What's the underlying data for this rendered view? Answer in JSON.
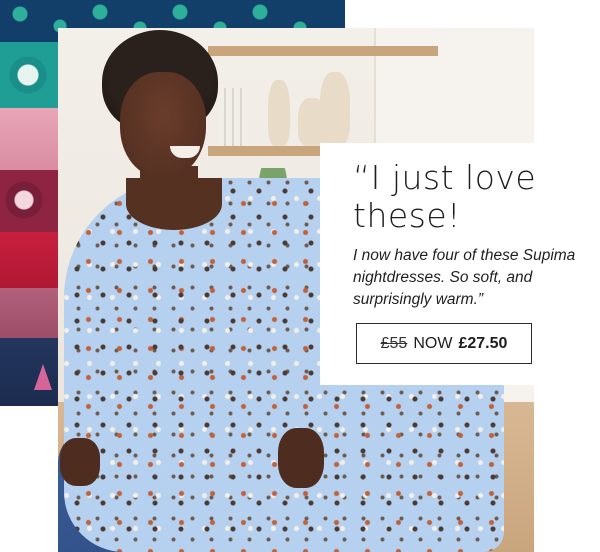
{
  "quote": {
    "headline_line1": "“I just love",
    "headline_line2": "these!",
    "body": "I now have four of these Supima nightdresses. So soft, and surprisingly warm.”"
  },
  "price": {
    "old": "£55",
    "now_label": "NOW",
    "new": "£27.50"
  },
  "colors": {
    "dress": "#b6d1ef",
    "card": "#ffffff",
    "text": "#1d1d1d"
  }
}
